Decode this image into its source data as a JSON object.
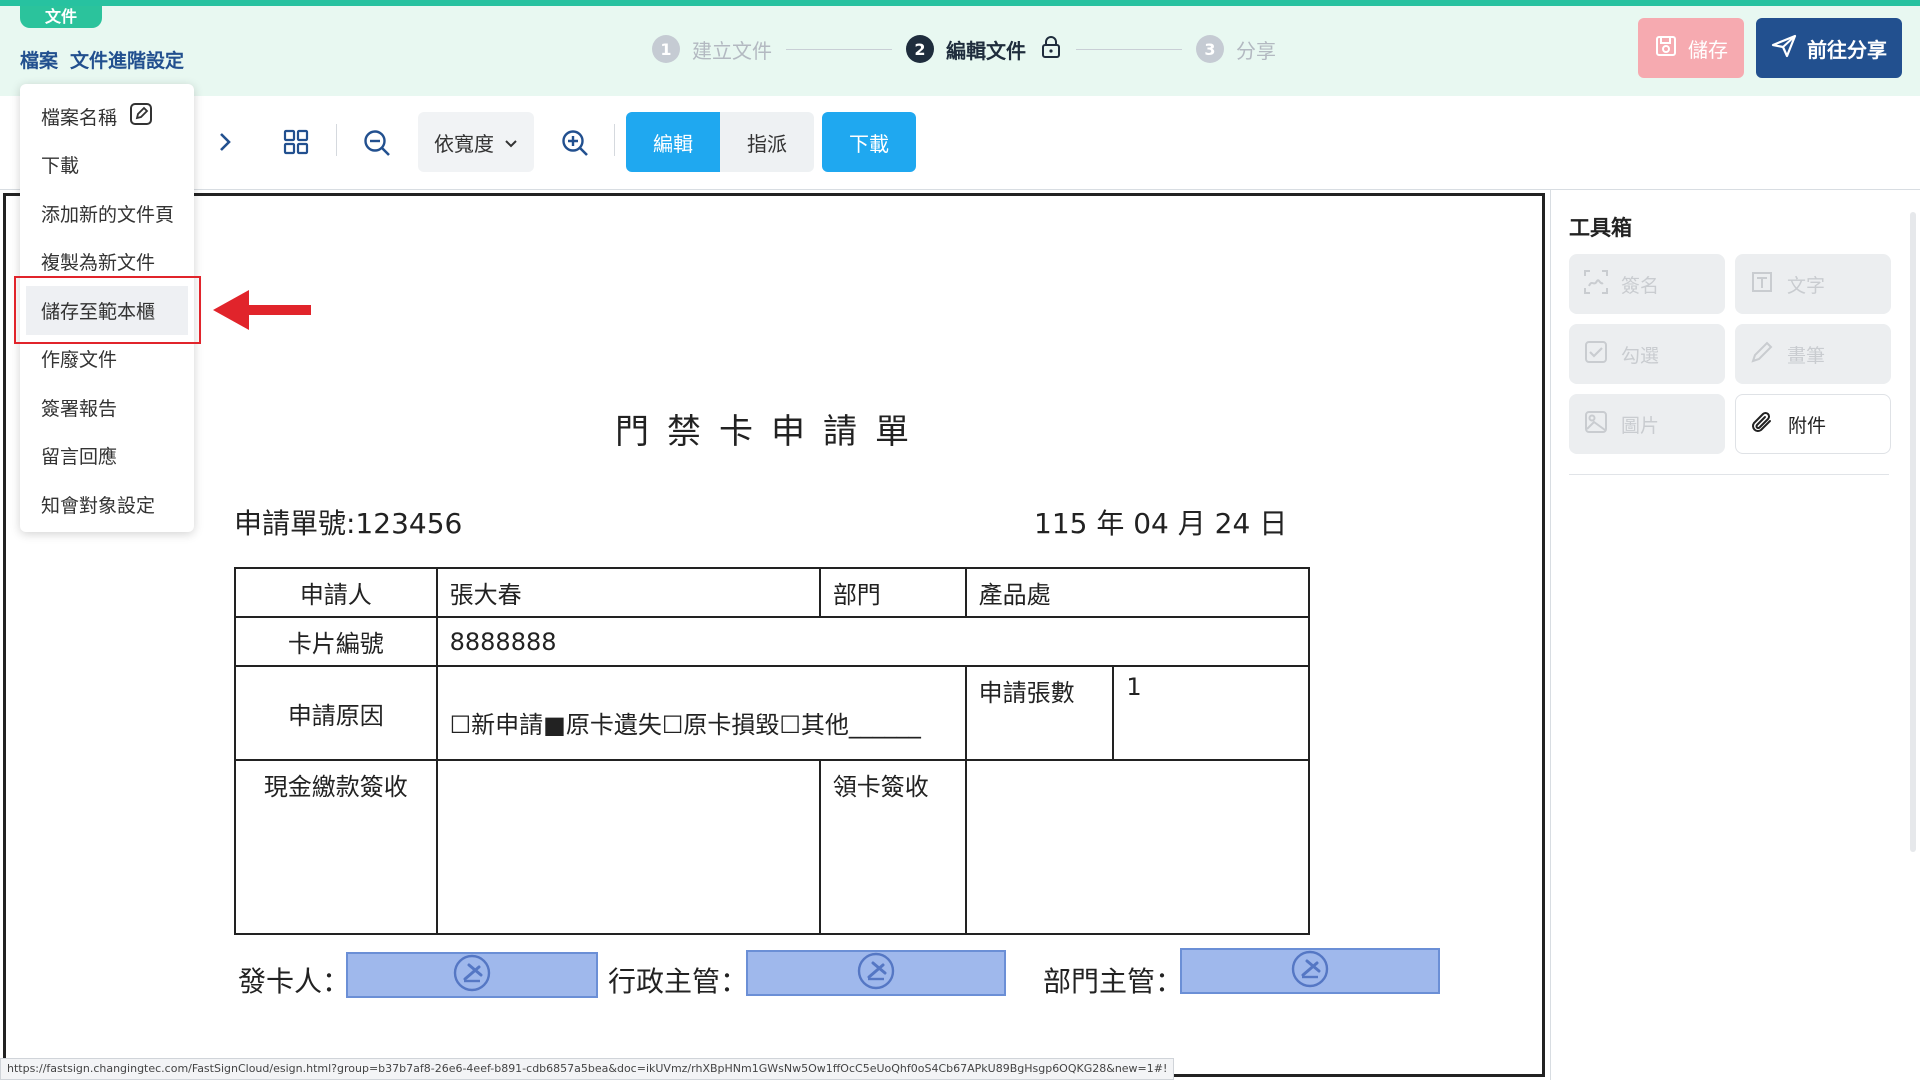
{
  "header": {
    "doc_tag": "文件",
    "file_menu": "檔案",
    "advanced_menu": "文件進階設定",
    "steps": [
      {
        "num": "1",
        "label": "建立文件",
        "state": "inactive"
      },
      {
        "num": "2",
        "label": "編輯文件",
        "state": "active"
      },
      {
        "num": "3",
        "label": "分享",
        "state": "inactive"
      }
    ],
    "save_label": "儲存",
    "share_label": "前往分享"
  },
  "toolbar": {
    "zoom_label": "依寬度",
    "mode_edit": "編輯",
    "mode_assign": "指派",
    "download_label": "下載"
  },
  "file_dropdown": {
    "items": [
      "檔案名稱",
      "下載",
      "添加新的文件頁",
      "複製為新文件",
      "儲存至範本櫃",
      "作廢文件",
      "簽署報告",
      "留言回應",
      "知會對象設定"
    ],
    "highlighted_index": 4
  },
  "document": {
    "title": "門禁卡申請單",
    "number": "申請單號:123456",
    "date": "115 年 04 月 24 日",
    "table": {
      "applicant_label": "申請人",
      "applicant_value": "張大春",
      "dept_label": "部門",
      "dept_value": "產品處",
      "card_no_label": "卡片編號",
      "card_no_value": "8888888",
      "reason_label": "申請原因",
      "reason_value": "☐新申請■原卡遺失☐原卡損毀☐其他______",
      "qty_label": "申請張數",
      "qty_value": "1",
      "cash_label": "現金繳款簽收",
      "pickup_label": "領卡簽收"
    },
    "signers": [
      "發卡人：",
      "行政主管：",
      "部門主管："
    ]
  },
  "toolbox": {
    "title": "工具箱",
    "tools": [
      {
        "label": "簽名",
        "icon": "signature-icon",
        "enabled": false
      },
      {
        "label": "文字",
        "icon": "text-icon",
        "enabled": false
      },
      {
        "label": "勾選",
        "icon": "checkbox-icon",
        "enabled": false
      },
      {
        "label": "畫筆",
        "icon": "pen-icon",
        "enabled": false
      },
      {
        "label": "圖片",
        "icon": "image-icon",
        "enabled": false
      },
      {
        "label": "附件",
        "icon": "paperclip-icon",
        "enabled": true
      }
    ]
  },
  "status_url": "https://fastsign.changingtec.com/FastSignCloud/esign.html?group=b37b7af8-26e6-4eef-b891-cdb6857a5bea&doc=ikUVmz/rhXBpHNm1GWsNw5Ow1ffOcC5eUoQhf0oS4Cb67APkU89BgHsgp6OQKG28&new=1#!",
  "colors": {
    "accent": "#1fa8f0",
    "brand": "#22508f",
    "header_bg": "#e8f8f1",
    "highlight_red": "#e1242b",
    "signature_field": "#9fb8ec"
  }
}
